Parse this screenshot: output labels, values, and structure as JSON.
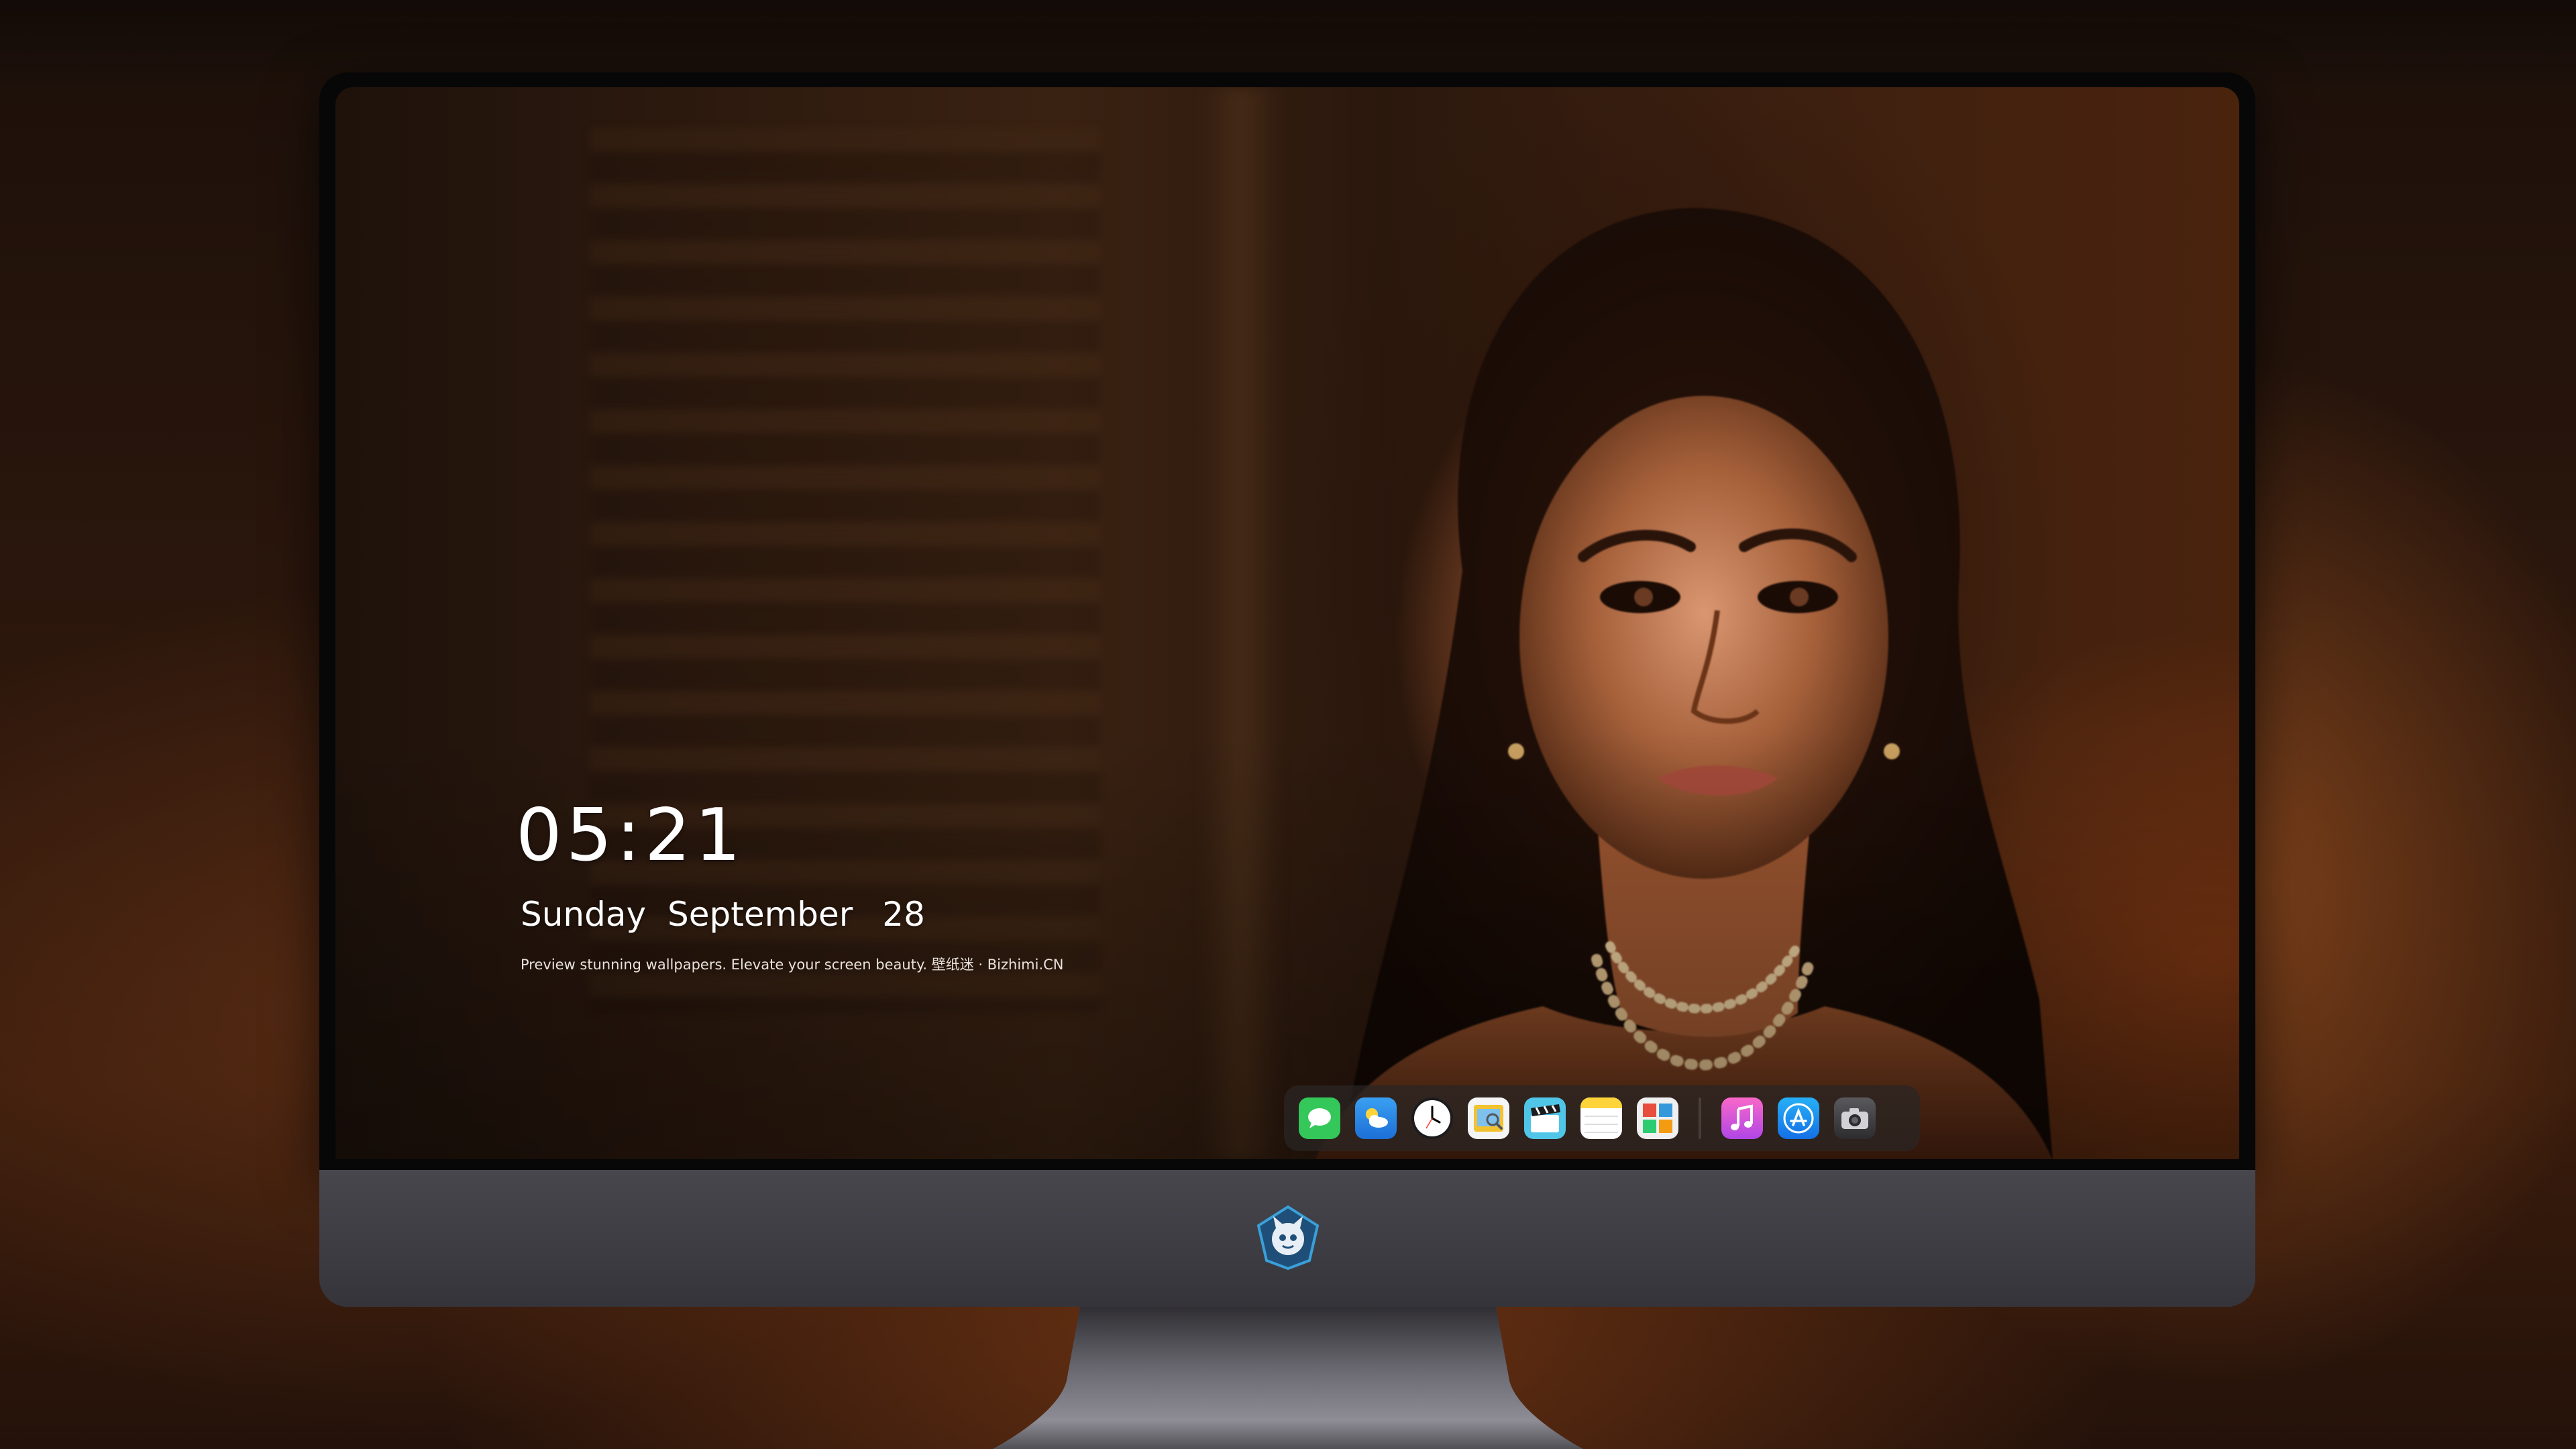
{
  "lockscreen": {
    "time": "05:21",
    "weekday": "Sunday",
    "month": "September",
    "day": "28",
    "tagline": "Preview stunning wallpapers. Elevate your screen beauty. 壁纸迷 · Bizhimi.CN"
  },
  "dock": {
    "apps": [
      {
        "name": "messages-icon",
        "color": "#34c759"
      },
      {
        "name": "weather-icon",
        "color": "#2f8de4"
      },
      {
        "name": "clock-icon",
        "color": "#ffffff"
      },
      {
        "name": "preview-icon",
        "color": "#f2c230"
      },
      {
        "name": "clips-icon",
        "color": "#4fc6e8"
      },
      {
        "name": "notes-icon",
        "color": "#ffd43b"
      },
      {
        "name": "photo-booth-icon",
        "color": "#e74c3c"
      },
      {
        "name": "music-icon",
        "color": "#d957e3"
      },
      {
        "name": "app-store-icon",
        "color": "#1d8cf8"
      },
      {
        "name": "camera-icon",
        "color": "#8e8e93"
      }
    ]
  },
  "brand": {
    "logo": "mascot-logo-icon",
    "accent": "#3aa0d8"
  }
}
